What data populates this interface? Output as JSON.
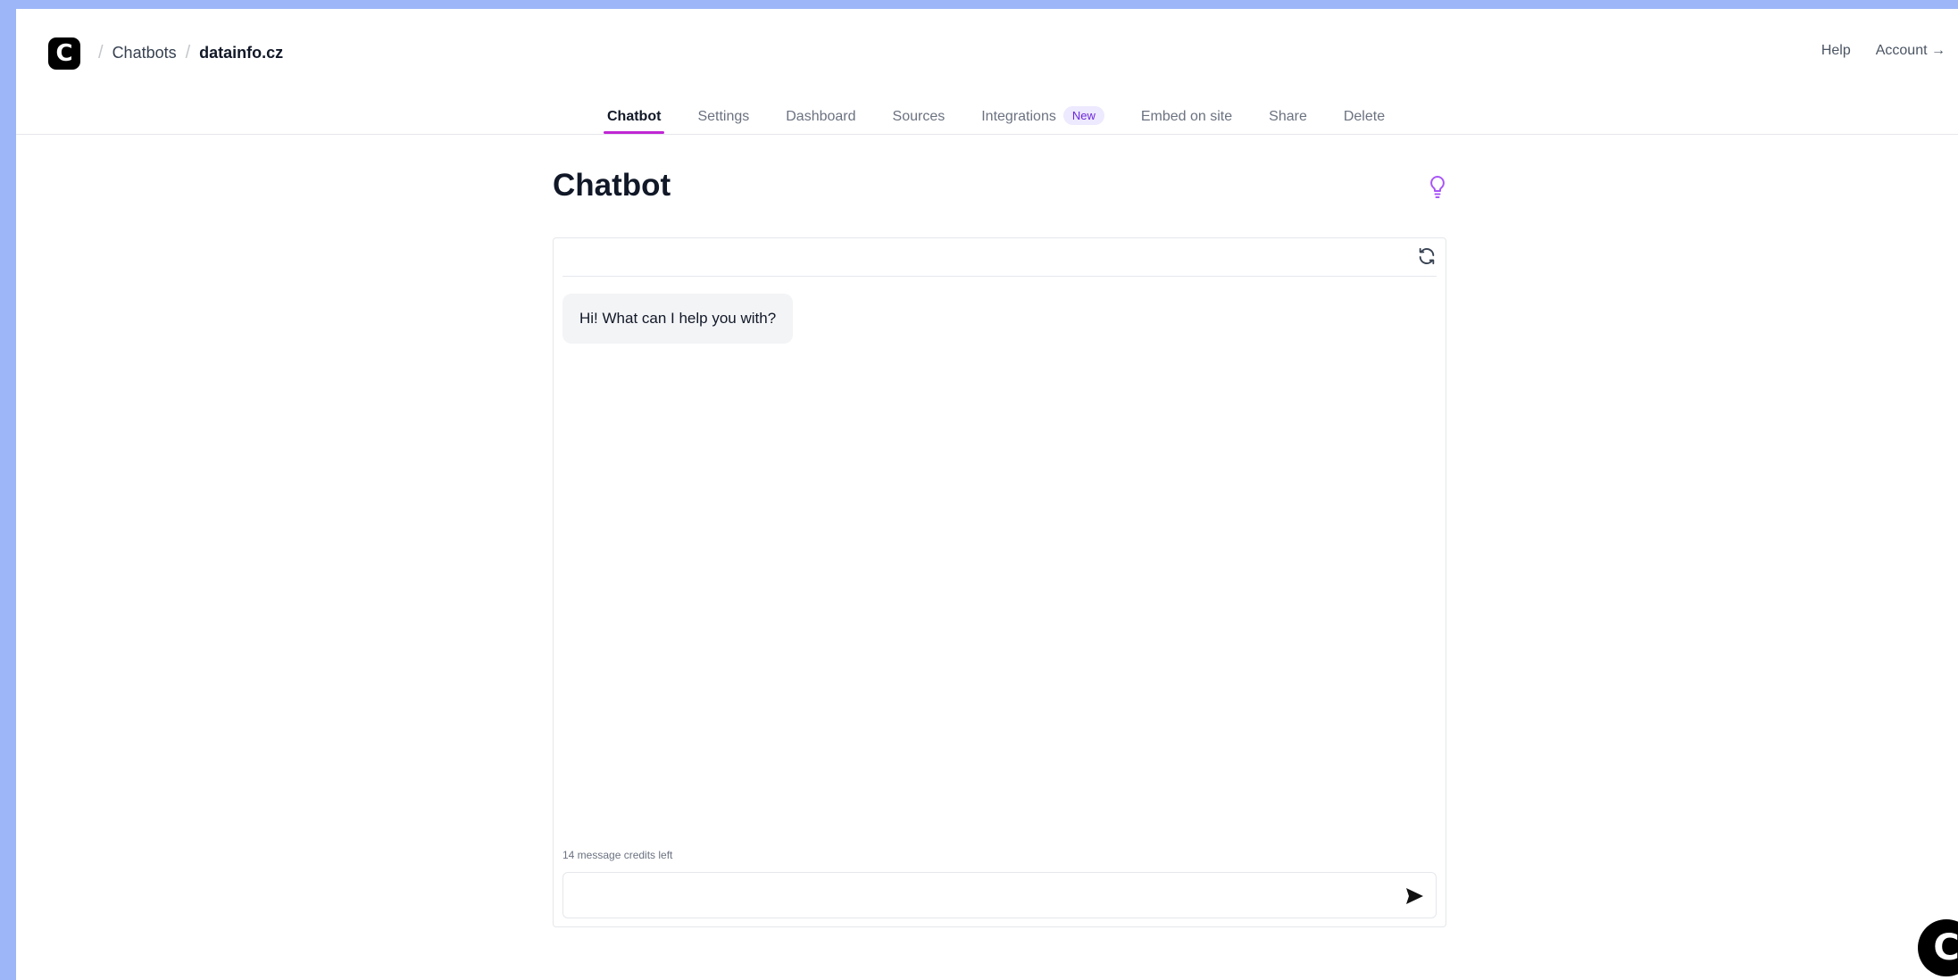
{
  "logo": {
    "letter": "C"
  },
  "breadcrumb": {
    "items": [
      "Chatbots"
    ],
    "current": "datainfo.cz",
    "separator": "/"
  },
  "top_right": {
    "help": "Help",
    "account": "Account →"
  },
  "tabs": [
    {
      "label": "Chatbot",
      "active": true
    },
    {
      "label": "Settings"
    },
    {
      "label": "Dashboard"
    },
    {
      "label": "Sources"
    },
    {
      "label": "Integrations",
      "badge": "New"
    },
    {
      "label": "Embed on site"
    },
    {
      "label": "Share"
    },
    {
      "label": "Delete"
    }
  ],
  "page": {
    "title": "Chatbot"
  },
  "chat": {
    "greeting": "Hi! What can I help you with?",
    "credits": "14 message credits left",
    "input_value": "",
    "input_placeholder": ""
  },
  "icons": {
    "hint": "lightbulb-icon",
    "reset": "refresh-icon",
    "send": "send-icon"
  },
  "colors": {
    "accent": "#c026d3",
    "badge_bg": "#ede9fe",
    "badge_text": "#6d28d9",
    "bulb": "#a855f7",
    "frame_bg": "#9db6f7"
  }
}
